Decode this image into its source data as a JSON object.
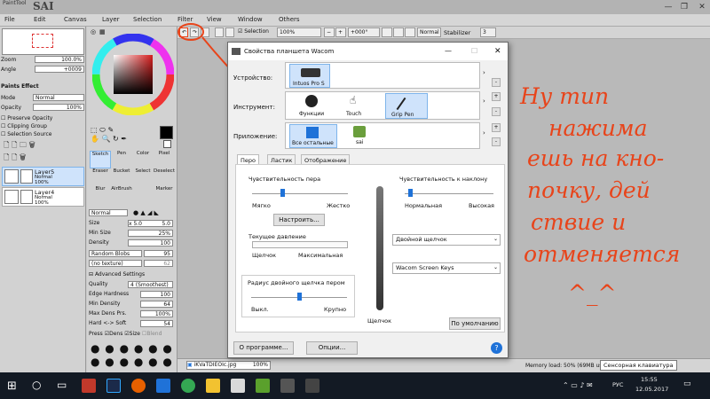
{
  "app": {
    "brand_small": "PaintTool",
    "brand_big": "SAI",
    "menu": [
      "File",
      "Edit",
      "Canvas",
      "Layer",
      "Selection",
      "Filter",
      "View",
      "Window",
      "Others"
    ]
  },
  "toolbar": {
    "selection_label": "Selection",
    "zoom": "100%",
    "angle": "+000°",
    "blend": "Normal",
    "stabilizer_label": "Stabilizer",
    "stabilizer_value": "3"
  },
  "navigator": {
    "zoom_label": "Zoom",
    "zoom_value": "100.0%",
    "angle_label": "Angle",
    "angle_value": "+0009"
  },
  "layer_panel": {
    "paints_effect": "Paints Effect",
    "mode_label": "Mode",
    "mode_value": "Normal",
    "opacity_label": "Opacity",
    "opacity_value": "100%",
    "preserve_opacity": "Preserve Opacity",
    "clipping_group": "Clipping Group",
    "selection_source": "Selection Source",
    "layers": [
      {
        "name": "Layer5",
        "mode": "Normal",
        "opacity": "100%"
      },
      {
        "name": "Layer4",
        "mode": "Normal",
        "opacity": "100%"
      }
    ]
  },
  "tool_panel": {
    "tools": [
      "Sketch",
      "Pen",
      "Color",
      "Pixel",
      "Eraser",
      "Bucket",
      "Select",
      "Deselect",
      "Blur",
      "AirBrush",
      "",
      "Marker"
    ],
    "blend_mode": "Normal",
    "size_label": "Size",
    "size_mult": "x 5.0",
    "size_value": "5.0",
    "min_size_label": "Min Size",
    "min_size_value": "25%",
    "density_label": "Density",
    "density_value": "100",
    "random_blobs": "Random Blobs",
    "random_blobs_value": "95",
    "no_texture": "(no texture)",
    "no_texture_value": "62",
    "advanced": "Advanced Settings",
    "quality_label": "Quality",
    "quality_value": "4 (Smoothest)",
    "edge_hardness_label": "Edge Hardness",
    "edge_hardness_value": "100",
    "min_density_label": "Min Density",
    "min_density_value": "64",
    "max_dens_label": "Max Dens Prs.",
    "max_dens_value": "100%",
    "hard_soft_label": "Hard <-> Soft",
    "hard_soft_value": "54",
    "press_label": "Press",
    "dens_label": "Dens",
    "size2_label": "Size",
    "blend_label": "Blend"
  },
  "statusbar": {
    "file_name": "iKVaTDIEOIc.jpg",
    "file_zoom": "100%",
    "memory": "Memory load: 50% (69MB us",
    "osk": "Сенсорная клавиатура"
  },
  "dialog": {
    "title": "Свойства планшета Wacom",
    "device_label": "Устройство:",
    "device_name": "Intuos Pro S",
    "tool_label": "Инструмент:",
    "tools": [
      "Функции",
      "Touch",
      "Grip Pen"
    ],
    "app_label": "Приложение:",
    "apps": [
      "Все остальные",
      "sai"
    ],
    "tabs": [
      "Перо",
      "Ластик",
      "Отображение"
    ],
    "pen_feel_label": "Чувствительность пера",
    "soft_label": "Мягко",
    "firm_label": "Жестко",
    "customize_button": "Настроить...",
    "current_pressure_label": "Текущее давление",
    "click_label": "Щелчок",
    "max_label": "Максимальная",
    "tilt_label": "Чувствительность к наклону",
    "normal_label": "Нормальная",
    "high_label": "Высокая",
    "double_click_value": "Двойной щелчок",
    "wacom_keys_value": "Wacom Screen Keys",
    "dbl_radius_label": "Радиус двойного щелчка пером",
    "off_label": "Выкл.",
    "large_label": "Крупно",
    "tip_label": "Щелчок",
    "default_button": "По умолчанию",
    "about_button": "О программе...",
    "options_button": "Опции...",
    "help_icon_label": "?"
  },
  "handwriting": [
    "Ну тип",
    "нажима",
    "ешь на кно-",
    "почку, дей",
    "ствие и",
    "отменяется",
    "^_^"
  ],
  "taskbar": {
    "time": "15:55",
    "date": "12.05.2017",
    "lang": "РУС"
  },
  "colors": {
    "annotation": "#e8441a",
    "accent": "#1f72d8",
    "selection": "#cfe3fb"
  }
}
